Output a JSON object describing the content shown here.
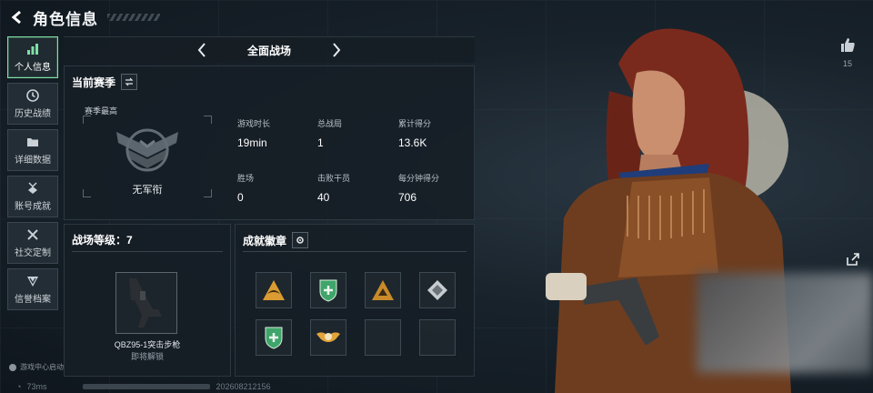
{
  "header": {
    "title": "角色信息"
  },
  "sidebar": {
    "items": [
      {
        "label": "个人信息",
        "icon": "bar-chart-icon",
        "active": true
      },
      {
        "label": "历史战绩",
        "icon": "clock-icon"
      },
      {
        "label": "详细数据",
        "icon": "folder-icon"
      },
      {
        "label": "账号成就",
        "icon": "medal-icon"
      },
      {
        "label": "社交定制",
        "icon": "tools-icon"
      },
      {
        "label": "信誉档案",
        "icon": "shield-icon"
      }
    ],
    "footer": "游戏中心启动"
  },
  "status": {
    "ping": "73ms",
    "id": "2026082121​56"
  },
  "mode": {
    "title": "全面战场"
  },
  "season": {
    "title": "当前赛季",
    "subtitle": "赛季最高",
    "rank": "无军衔",
    "stats": [
      {
        "label": "游戏时长",
        "value": "19min"
      },
      {
        "label": "总战局",
        "value": "1"
      },
      {
        "label": "累计得分",
        "value": "13.6K"
      },
      {
        "label": "胜场",
        "value": "0"
      },
      {
        "label": "击败干员",
        "value": "40"
      },
      {
        "label": "每分钟得分",
        "value": "706"
      }
    ]
  },
  "level": {
    "title": "战场等级：7",
    "weapon_name": "QBZ95-1突击步枪",
    "weapon_status": "即将解锁"
  },
  "badges": {
    "title": "成就徽章",
    "items": [
      "eagle-badge-icon",
      "shield-plus-badge-icon",
      "eagle-badge-icon",
      "diamond-badge-icon",
      "shield-plus-badge-icon",
      "winged-skull-badge-icon",
      "empty",
      "empty"
    ]
  },
  "social": {
    "likes": "15"
  },
  "colors": {
    "accent": "#7fe0a4",
    "badge_gold": "#e2a43a",
    "badge_green": "#3fa56a"
  }
}
